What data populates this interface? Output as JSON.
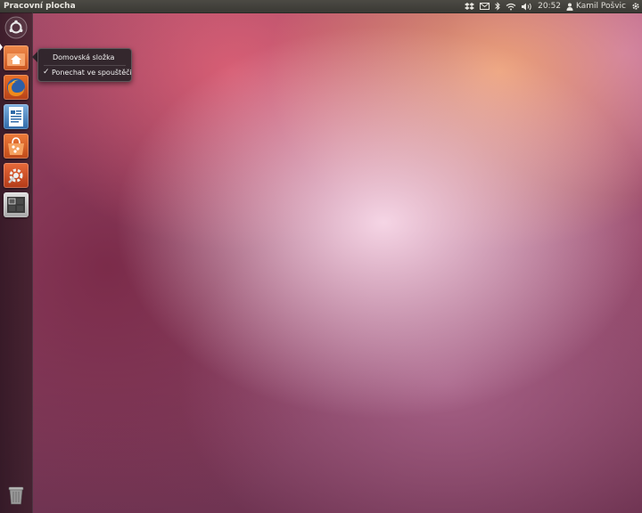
{
  "panel": {
    "title": "Pracovní plocha",
    "clock": "20:52",
    "user": "Kamil Pošvic",
    "indicators": [
      "dropbox-icon",
      "mail-icon",
      "bluetooth-icon",
      "wifi-icon",
      "volume-icon"
    ]
  },
  "launcher": {
    "items": [
      {
        "name": "dash-home",
        "icon": "ubuntu-logo-icon"
      },
      {
        "name": "home-folder",
        "icon": "home-folder-icon"
      },
      {
        "name": "firefox",
        "icon": "firefox-icon"
      },
      {
        "name": "libreoffice-writer",
        "icon": "writer-icon"
      },
      {
        "name": "software-center",
        "icon": "software-center-icon"
      },
      {
        "name": "system-settings",
        "icon": "settings-icon"
      },
      {
        "name": "workspace-switcher",
        "icon": "workspace-icon"
      },
      {
        "name": "trash",
        "icon": "trash-icon"
      }
    ]
  },
  "quicklist": {
    "title": "Domovská složka",
    "items": [
      {
        "label": "Ponechat ve spouštěči",
        "checked": true
      }
    ]
  },
  "colors": {
    "panel_bg": "#3c3b37",
    "accent_orange": "#dd4814",
    "wallpaper_base": "#9b4d6f"
  }
}
